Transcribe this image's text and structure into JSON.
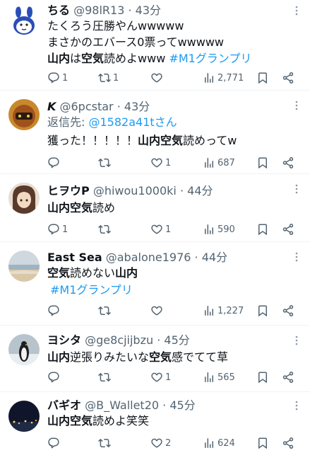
{
  "tweets": [
    {
      "name": "ちる",
      "handle": "@98lR13",
      "dot": "·",
      "time": "43分",
      "line1": "たくろう圧勝やんwwwww",
      "line2": "まさかのエバース0票ってwwwww",
      "line3_a": "山内",
      "line3_b": "は",
      "line3_c": "空気",
      "line3_d": "読めよwww",
      "hashtag": "#M1グランプリ",
      "reply_count": "1",
      "retweet_count": "1",
      "like_count": "",
      "view_count": "2,771"
    },
    {
      "name": "K",
      "handle": "@6pcstar",
      "dot": "·",
      "time": "43分",
      "reply_to_label": "返信先: ",
      "reply_to_handle": "@1582a41tさん",
      "line_a": "獲った！！！！！",
      "line_b": "山内空気",
      "line_c": "読めってw",
      "reply_count": "",
      "retweet_count": "",
      "like_count": "1",
      "view_count": "687"
    },
    {
      "name": "ヒヲウP",
      "handle": "@hiwou1000ki",
      "dot": "·",
      "time": "44分",
      "line_a": "山内空気",
      "line_b": "読め",
      "reply_count": "1",
      "retweet_count": "",
      "like_count": "1",
      "view_count": "590"
    },
    {
      "name": "East Sea",
      "handle": "@abalone1976",
      "dot": "·",
      "time": "44分",
      "line_a": "空気",
      "line_b": "読めない",
      "line_c": "山内",
      "hashtag": "#M1グランプリ",
      "reply_count": "",
      "retweet_count": "",
      "like_count": "",
      "view_count": "1,227"
    },
    {
      "name": "ヨシタ",
      "handle": "@ge8cjijbzu",
      "dot": "·",
      "time": "45分",
      "line_a": "山内",
      "line_b": "逆張りみたいな",
      "line_c": "空気",
      "line_d": "感でてて草",
      "reply_count": "",
      "retweet_count": "",
      "like_count": "1",
      "view_count": "565"
    },
    {
      "name": "バギオ",
      "handle": "@B_Wallet20",
      "dot": "·",
      "time": "45分",
      "line_a": "山内空気",
      "line_b": "読めよ笑笑",
      "reply_count": "",
      "retweet_count": "",
      "like_count": "2",
      "view_count": "624"
    }
  ],
  "colors": {
    "text": "#0f1419",
    "secondary": "#536471",
    "link": "#1d9bf0",
    "divider": "#eff3f4"
  },
  "icons": [
    "reply-icon",
    "retweet-icon",
    "like-icon",
    "views-icon",
    "bookmark-icon",
    "share-icon",
    "more-icon"
  ]
}
